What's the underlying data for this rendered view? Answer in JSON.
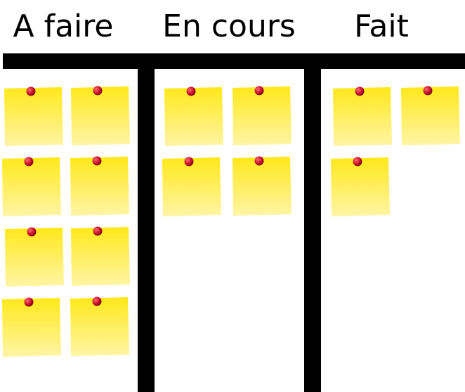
{
  "board": {
    "columns": [
      {
        "title": "A faire",
        "note_count": 8
      },
      {
        "title": "En cours",
        "note_count": 4
      },
      {
        "title": "Fait",
        "note_count": 3
      }
    ]
  },
  "colors": {
    "line": "#000000",
    "note_top": "#ffe81a",
    "note_bottom": "#fff5a6",
    "pin": "#c8102e"
  }
}
